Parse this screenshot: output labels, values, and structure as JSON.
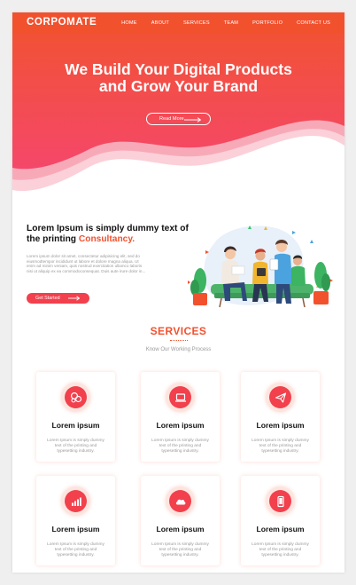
{
  "brand": {
    "logo": "CORPOMATE",
    "accent": "#f2512e",
    "button_red": "#f2404d"
  },
  "nav": {
    "items": [
      {
        "label": "HOME"
      },
      {
        "label": "ABOUT"
      },
      {
        "label": "SERVICES"
      },
      {
        "label": "TEAM"
      },
      {
        "label": "PORTFOLIO"
      },
      {
        "label": "CONTACT US"
      }
    ]
  },
  "hero": {
    "title_line1": "We Build Your Digital Products",
    "title_line2": "and Grow Your Brand",
    "button_label": "Read More"
  },
  "intro": {
    "title_part1": "Lorem Ipsum is simply dummy text of the printing ",
    "title_accent": "Consultancy.",
    "body": "Lorem ipsum dolor sit amet, consectetur adipisicing elit, sed do eiusmodtempor incididunt ut labore et dolore magna aliqua. Ut enim ad minim veniam, quis nostrud exercitation ullamco laboris nisi ut aliquip ex ea commodoconsequat. Duis aute irure dolor in...",
    "button_label": "Get Started"
  },
  "services": {
    "title": "SERVICES",
    "subtitle": "Know Our Working Process",
    "cards": [
      {
        "icon": "bubbles-icon",
        "name": "Lorem ipsum",
        "desc": "Lorem Ipsum is simply dummy text of the printing and typesetting industry."
      },
      {
        "icon": "laptop-icon",
        "name": "Lorem ipsum",
        "desc": "Lorem Ipsum is simply dummy text of the printing and typesetting industry."
      },
      {
        "icon": "paper-plane-icon",
        "name": "Lorem ipsum",
        "desc": "Lorem Ipsum is simply dummy text of the printing and typesetting industry."
      },
      {
        "icon": "bar-chart-icon",
        "name": "Lorem ipsum",
        "desc": "Lorem Ipsum is simply dummy text of the printing and typesetting industry."
      },
      {
        "icon": "cloud-icon",
        "name": "Lorem ipsum",
        "desc": "Lorem Ipsum is simply dummy text of the printing and typesetting industry."
      },
      {
        "icon": "mobile-icon",
        "name": "Lorem ipsum",
        "desc": "Lorem Ipsum is simply dummy text of the printing and typesetting industry."
      }
    ]
  }
}
